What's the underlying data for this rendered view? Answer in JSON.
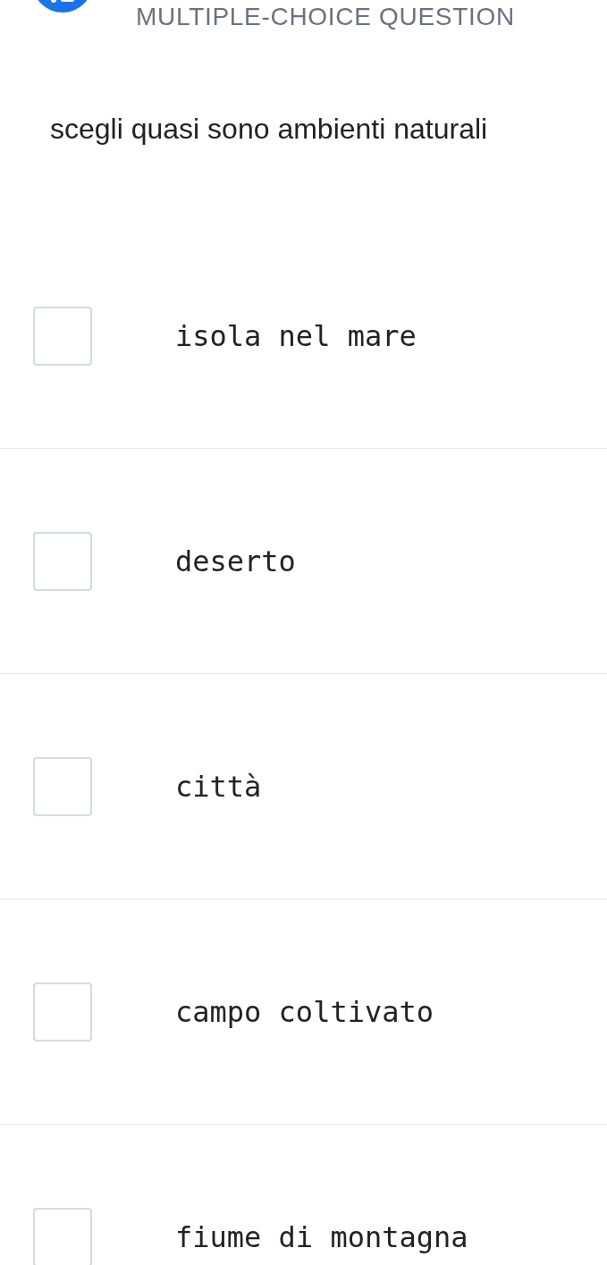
{
  "header": {
    "label": "MULTIPLE-CHOICE QUESTION"
  },
  "question": "scegli quasi sono ambienti naturali",
  "options": [
    {
      "label": "isola nel mare",
      "checked": false
    },
    {
      "label": "deserto",
      "checked": false
    },
    {
      "label": "città",
      "checked": false
    },
    {
      "label": "campo coltivato",
      "checked": false
    },
    {
      "label": "fiume di montagna",
      "checked": false
    }
  ]
}
